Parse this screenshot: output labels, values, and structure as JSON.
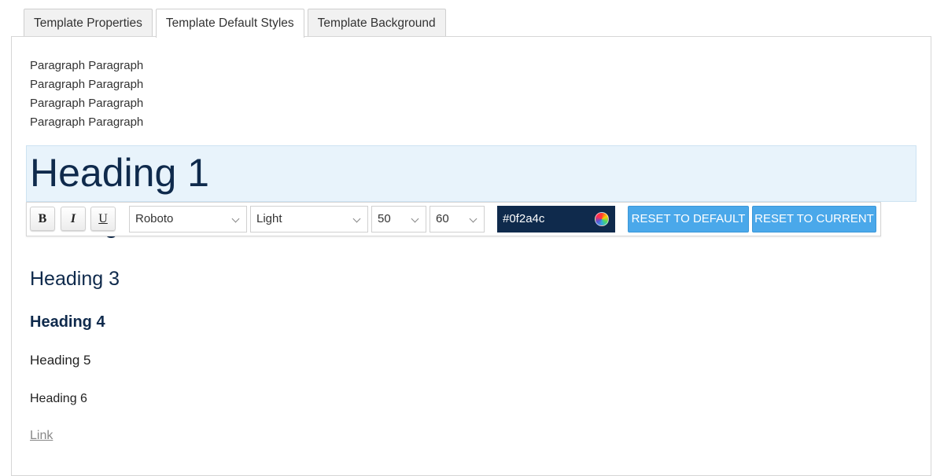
{
  "tabs": [
    {
      "label": "Template Properties",
      "active": false
    },
    {
      "label": "Template Default Styles",
      "active": true
    },
    {
      "label": "Template Background",
      "active": false
    }
  ],
  "content": {
    "paragraphs": [
      "Paragraph Paragraph",
      "Paragraph Paragraph",
      "Paragraph Paragraph",
      "Paragraph Paragraph"
    ],
    "heading1": "Heading 1",
    "heading2": "Heading 2",
    "heading3": "Heading 3",
    "heading4": "Heading 4",
    "heading5": "Heading 5",
    "heading6": "Heading 6",
    "link": "Link"
  },
  "toolbar": {
    "bold_label": "B",
    "italic_label": "I",
    "underline_label": "U",
    "font_family": "Roboto",
    "font_weight": "Light",
    "font_size": "50",
    "line_height": "60",
    "color_value": "#0f2a4c",
    "reset_default_label": "RESET TO DEFAULT",
    "reset_current_label": "RESET TO CURRENT"
  },
  "colors": {
    "heading_color": "#0f2a4c",
    "selected_highlight": "#e8f3fb",
    "button_blue": "#4aa8ea"
  }
}
